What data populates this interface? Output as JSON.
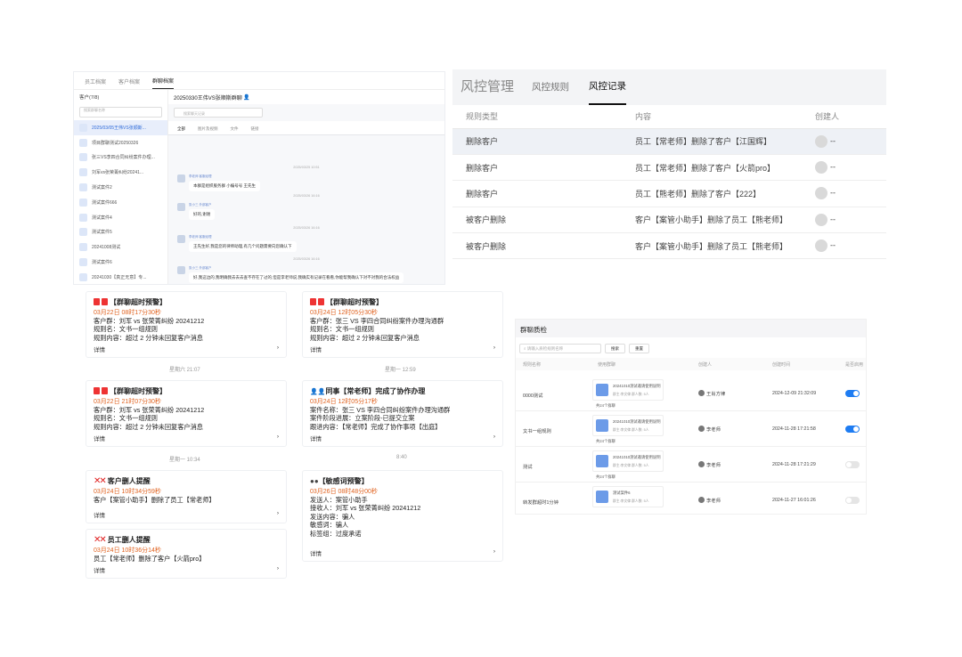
{
  "chat": {
    "tabs": [
      "员工档案",
      "客户档案",
      "群聊档案"
    ],
    "active_tab": 2,
    "sidebar_title": "客户(7/8)",
    "search_placeholder": "搜索群聊名称",
    "items": [
      "2025/03/05王伟VS张顺斯...",
      "项目群聊测试20250326",
      "张三VS李四合同纠纷案件办理...",
      "刘军vs张荣菁纠纷20241...",
      "测试案件2",
      "测试案件666",
      "测试案件4",
      "测试案件5",
      "20241008测试",
      "测试案件6",
      "20241030【真正无意】专..."
    ],
    "title": "20250330王伟VS张顺斯群聊",
    "search": "搜索聊天记录",
    "mtabs": [
      "全部",
      "图片及视频",
      "文件",
      "链接"
    ],
    "msgs": [
      {
        "time": "2025/03/25 10:51",
        "name": "李老师 客服经理",
        "text": "本群是组织服务群 小编号号 王先生"
      },
      {
        "time": "2025/03/26 16:16",
        "name": "张小三 外部客户",
        "text": "好的,谢谢"
      },
      {
        "time": "2025/03/26 16:16",
        "name": "李老师 客服经理",
        "text": "王先生好,我是您的律师助理,有几个问题需要向您确认下"
      },
      {
        "time": "2025/03/26 16:16",
        "name": "张小三 外部客户",
        "text": "好,我这边的,我明确我去去去查不存在了过的,但是李老师说,我确实有记录在看看,你能帮我确认下对不对我的合法权益"
      }
    ]
  },
  "risk": {
    "title": "风控管理",
    "tabs": [
      "风控规则",
      "风控记录"
    ],
    "active_tab": 1,
    "headers": [
      "规则类型",
      "内容",
      "创建人"
    ],
    "rows": [
      {
        "type": "删除客户",
        "content": "员工【常老师】删除了客户【江国辉】",
        "by": "--"
      },
      {
        "type": "删除客户",
        "content": "员工【常老师】删除了客户【火箭pro】",
        "by": "--"
      },
      {
        "type": "删除客户",
        "content": "员工【熊老师】删除了客户【222】",
        "by": "--"
      },
      {
        "type": "被客户删除",
        "content": "客户【案管小助手】删除了员工【熊老师】",
        "by": "--"
      },
      {
        "type": "被客户删除",
        "content": "客户【案管小助手】删除了员工【熊老师】",
        "by": "--"
      }
    ]
  },
  "cards": [
    {
      "icon": "alert",
      "title": "【群聊超时预警】",
      "time": "03月22日 08时17分30秒",
      "lines": [
        "客户群：刘军 vs 张荣菁纠纷 20241212",
        "规则名：文书一组规则",
        "规则内容：超过 2 分钟未回复客户消息"
      ],
      "footer": "详情"
    },
    {
      "icon": "alert",
      "title": "【群聊超时预警】",
      "time": "03月24日 12时05分30秒",
      "lines": [
        "客户群：张三 VS 李四合同纠纷案件办理沟通群",
        "规则名：文书一组规则",
        "规则内容：超过 2 分钟未回复客户消息"
      ],
      "footer": "详情"
    },
    {
      "icon": "alert",
      "title": "【群聊超时预警】",
      "time": "03月22日 21时07分30秒",
      "lines": [
        "客户群：刘军 vs 张荣菁纠纷 20241212",
        "规则名：文书一组规则",
        "规则内容：超过 2 分钟未回复客户消息"
      ],
      "footer": "详情"
    },
    {
      "icon": "person",
      "title": "同事【常老师】完成了协作办理",
      "time": "03月24日 12时05分17秒",
      "lines": [
        "案件名称：张三 VS 李四合同纠纷案件办理沟通群",
        "案件阶段进展：立案阶段-已提交立案",
        "跟进内容：【常老师】完成了协作事项【出庭】"
      ],
      "footer": "详情"
    },
    {
      "icon": "x",
      "title": "客户删人提醒",
      "time": "03月24日 10时34分59秒",
      "lines": [
        "客户【案管小助手】删除了员工【常老师】"
      ],
      "footer": "详情"
    },
    {
      "icon": "bomb",
      "title": "【敏感词预警】",
      "time": "03月26日 08时48分00秒",
      "lines": [
        "发送人：案管小助手",
        "接收人：刘军 vs 张荣菁纠纷 20241212",
        "发送内容：骗人",
        "敏感词：骗人",
        "标签组：过度承诺"
      ],
      "footer": "详情"
    },
    {
      "icon": "x",
      "title": "员工删人提醒",
      "time": "03月24日 10时36分14秒",
      "lines": [
        "员工【常老师】删除了客户【火箭pro】"
      ],
      "footer": "详情"
    }
  ],
  "stamps": [
    "星期六 21:07",
    "星期一 12:59",
    "星期一 10:34",
    "8:40"
  ],
  "qc": {
    "title": "群聊质检",
    "search": "请输入质检规则名称",
    "btn_search": "搜索",
    "btn_reset": "重置",
    "headers": [
      "规则名称",
      "使用群聊",
      "创建人",
      "创建时间",
      "是否启用"
    ],
    "rows": [
      {
        "name": "0000测试",
        "group": "20241010测试邀请使用说明",
        "meta": "群主:李文律 群人数: 5人",
        "count": "共24个群聊",
        "creator": "王肖方律",
        "created": "2024-12-09 21:32:09",
        "on": true
      },
      {
        "name": "文书一组规则",
        "group": "20241010测试邀请使用说明",
        "meta": "群主:李文律 群人数: 5人",
        "count": "共24个群聊",
        "creator": "李老师",
        "created": "2024-11-28 17:21:58",
        "on": true
      },
      {
        "name": "测试",
        "group": "20241010测试邀请使用说明",
        "meta": "群主:李文律 群人数: 5人",
        "count": "共24个群聊",
        "creator": "李老师",
        "created": "2024-11-28 17:21:29",
        "on": false
      },
      {
        "name": "转发群超时1分钟",
        "group": "测试案件6",
        "meta": "群主:李文律 群人数: 5人",
        "count": "",
        "creator": "李老师",
        "created": "2024-11-27 16:01:26",
        "on": false
      }
    ]
  }
}
